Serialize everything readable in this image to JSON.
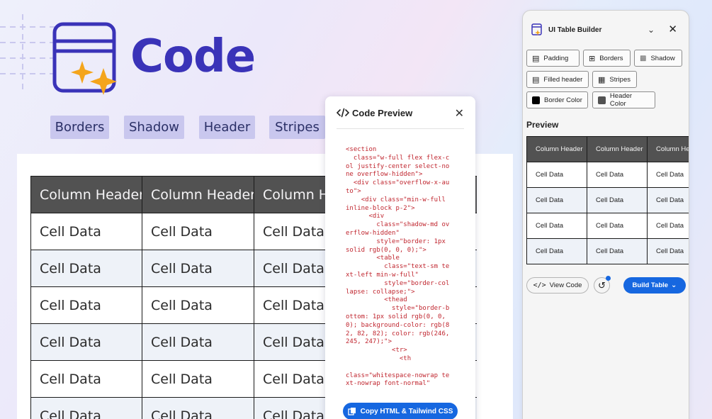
{
  "hero": {
    "title": "Code",
    "chips": [
      "Borders",
      "Shadow",
      "Header",
      "Stripes"
    ]
  },
  "big_table": {
    "headers": [
      "Column Header",
      "Column Header",
      "Column Header"
    ],
    "rows": [
      [
        "Cell Data",
        "Cell Data",
        "Cell Data"
      ],
      [
        "Cell Data",
        "Cell Data",
        "Cell Data"
      ],
      [
        "Cell Data",
        "Cell Data",
        "Cell Data"
      ],
      [
        "Cell Data",
        "Cell Data",
        "Cell Data"
      ],
      [
        "Cell Data",
        "Cell Data",
        "Cell Data"
      ],
      [
        "Cell Data",
        "Cell Data",
        "Cell Data"
      ]
    ]
  },
  "code_preview": {
    "icon": "code-brackets-icon",
    "title": "Code Preview",
    "code": "<section\n  class=\"w-full flex flex-col justify-center select-none overflow-hidden\">\n  <div class=\"overflow-x-auto\">\n    <div class=\"min-w-full inline-block p-2\">\n      <div\n        class=\"shadow-md overflow-hidden\"\n        style=\"border: 1px solid rgb(0, 0, 0);\">\n        <table\n          class=\"text-sm text-left min-w-full\"\n          style=\"border-collapse: collapse;\">\n          <thead\n            style=\"border-bottom: 1px solid rgb(0, 0, 0); background-color: rgb(82, 82, 82); color: rgb(246, 245, 247);\">\n            <tr>\n              <th\n\nclass=\"whitespace-nowrap text-nowrap font-normal\"",
    "copy_label": "Copy HTML & Tailwind CSS"
  },
  "builder": {
    "title": "UI Table Builder",
    "options": {
      "padding": "Padding",
      "borders": "Borders",
      "shadow": "Shadow",
      "filled_header": "Filled header",
      "stripes": "Stripes",
      "border_color": "Border Color",
      "header_color": "Header Color"
    },
    "border_color_swatch": "#000000",
    "header_color_swatch": "#525252",
    "preview_label": "Preview",
    "preview_table": {
      "headers": [
        "Column Header",
        "Column Header",
        "Column Header"
      ],
      "rows": [
        [
          "Cell Data",
          "Cell Data",
          "Cell Data"
        ],
        [
          "Cell Data",
          "Cell Data",
          "Cell Data"
        ],
        [
          "Cell Data",
          "Cell Data",
          "Cell Data"
        ],
        [
          "Cell Data",
          "Cell Data",
          "Cell Data"
        ]
      ]
    },
    "view_code_label": "View Code",
    "build_label": "Build Table"
  },
  "colors": {
    "brand_title": "#3a33b8",
    "accent_blue": "#1667e0",
    "header_bg": "#525252",
    "stripe_bg": "#eef2f8",
    "sparkle": "#f4a51c"
  }
}
